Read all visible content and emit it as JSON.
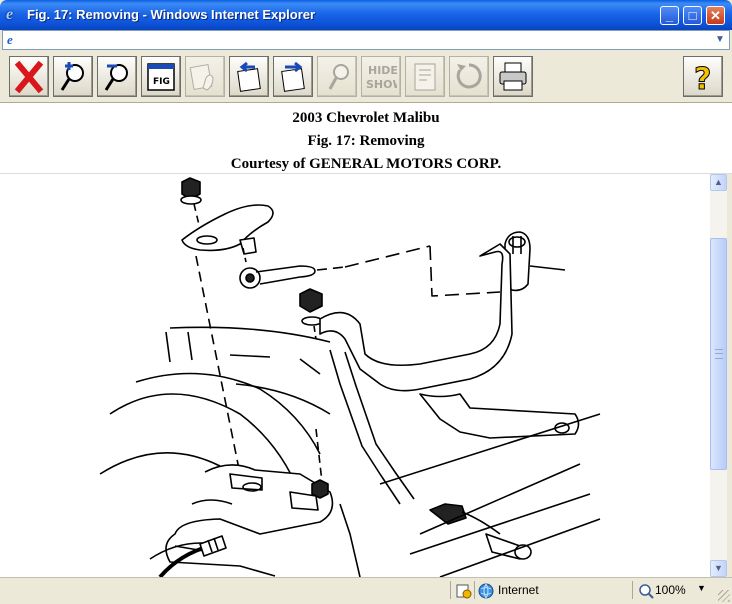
{
  "window": {
    "title": "Fig. 17: Removing - Windows Internet Explorer",
    "minimize": "_",
    "maximize": "□",
    "close": "✕"
  },
  "address": {
    "value": ""
  },
  "toolbar": {
    "hide_line1": "HIDE",
    "hide_line2": "SHOW",
    "fig_label": "FIG",
    "help_label": "?"
  },
  "content": {
    "line1": "2003 Chevrolet Malibu",
    "line2": "Fig. 17: Removing",
    "line3": "Courtesy of GENERAL MOTORS CORP."
  },
  "status": {
    "zone": "Internet",
    "zoom": "100%",
    "zoom_dropdown": "▼"
  },
  "colors": {
    "title_bar": "#1a66e8",
    "close_button": "#c43a1a",
    "window_chrome": "#ece9d8"
  }
}
